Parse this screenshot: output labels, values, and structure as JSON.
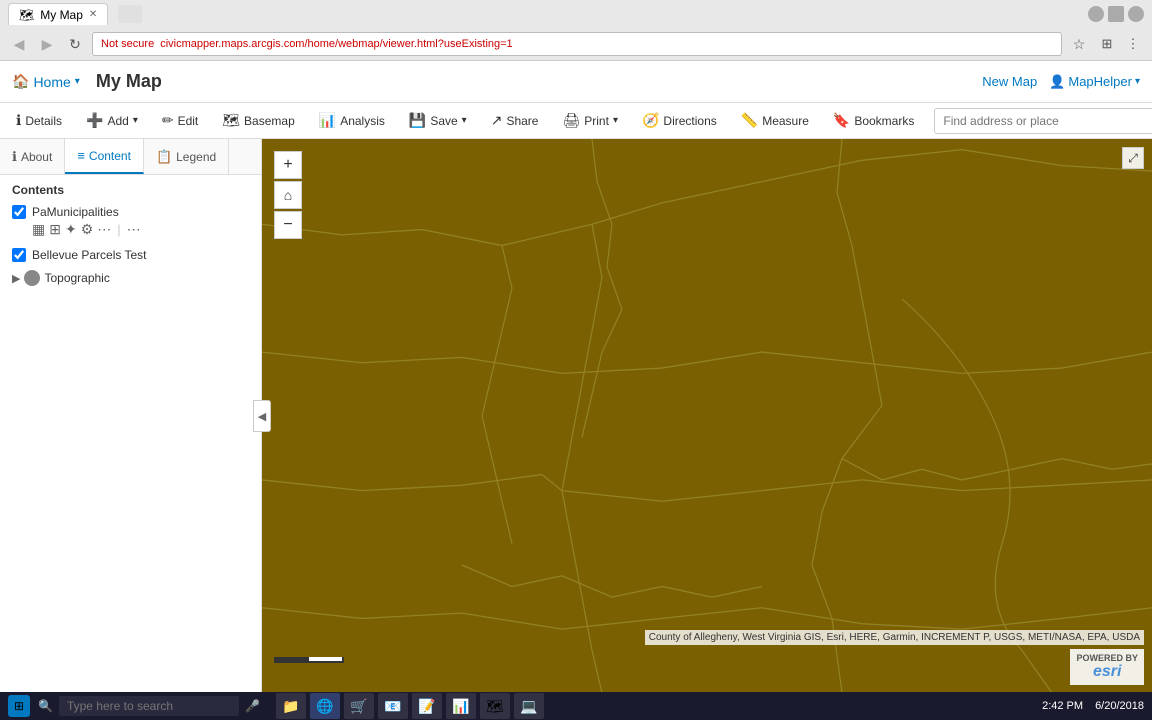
{
  "browser": {
    "tab_title": "My Map",
    "tab_icon": "🗺",
    "address": "civicmapper.maps.arcgis.com/home/webmap/viewer.html?useExisting=1",
    "security_label": "Not secure",
    "nav_back_disabled": true,
    "nav_forward_disabled": true
  },
  "app": {
    "home_label": "Home",
    "title": "My Map",
    "new_map_label": "New Map",
    "map_helper_label": "MapHelper"
  },
  "toolbar": {
    "details_label": "Details",
    "add_label": "Add",
    "edit_label": "Edit",
    "basemap_label": "Basemap",
    "analysis_label": "Analysis",
    "save_label": "Save",
    "share_label": "Share",
    "print_label": "Print",
    "directions_label": "Directions",
    "measure_label": "Measure",
    "bookmarks_label": "Bookmarks",
    "search_placeholder": "Find address or place",
    "search_btn_label": "🔍"
  },
  "sidebar": {
    "tab_about_label": "About",
    "tab_content_label": "Content",
    "tab_legend_label": "Legend",
    "active_tab": "Content",
    "contents_heading": "Contents",
    "collapse_icon": "◀"
  },
  "layers": [
    {
      "id": "municipalities",
      "name": "PaMunicipalities",
      "checked": true,
      "tools": [
        "table",
        "grid",
        "star",
        "filter",
        "style",
        "more"
      ]
    },
    {
      "id": "bellevue",
      "name": "Bellevue Parcels Test",
      "checked": true,
      "tools": []
    },
    {
      "id": "topographic",
      "name": "Topographic",
      "checked": false,
      "is_group": true
    }
  ],
  "map": {
    "zoom_in_label": "+",
    "zoom_out_label": "−",
    "home_label": "⌂",
    "attribution": "County of Allegheny, West Virginia GIS, Esri, HERE, Garmin, INCREMENT P, USGS, METI/NASA, EPA, USDA",
    "esri_powered": "POWERED BY",
    "esri_brand": "esri"
  },
  "taskbar": {
    "search_placeholder": "Type here to search",
    "time_label": "2:42 PM",
    "date_label": "6/20/2018",
    "apps": [
      "🪟",
      "📁",
      "🌐",
      "📋",
      "📁",
      "💻",
      "📊",
      "📝",
      "🎮"
    ]
  }
}
